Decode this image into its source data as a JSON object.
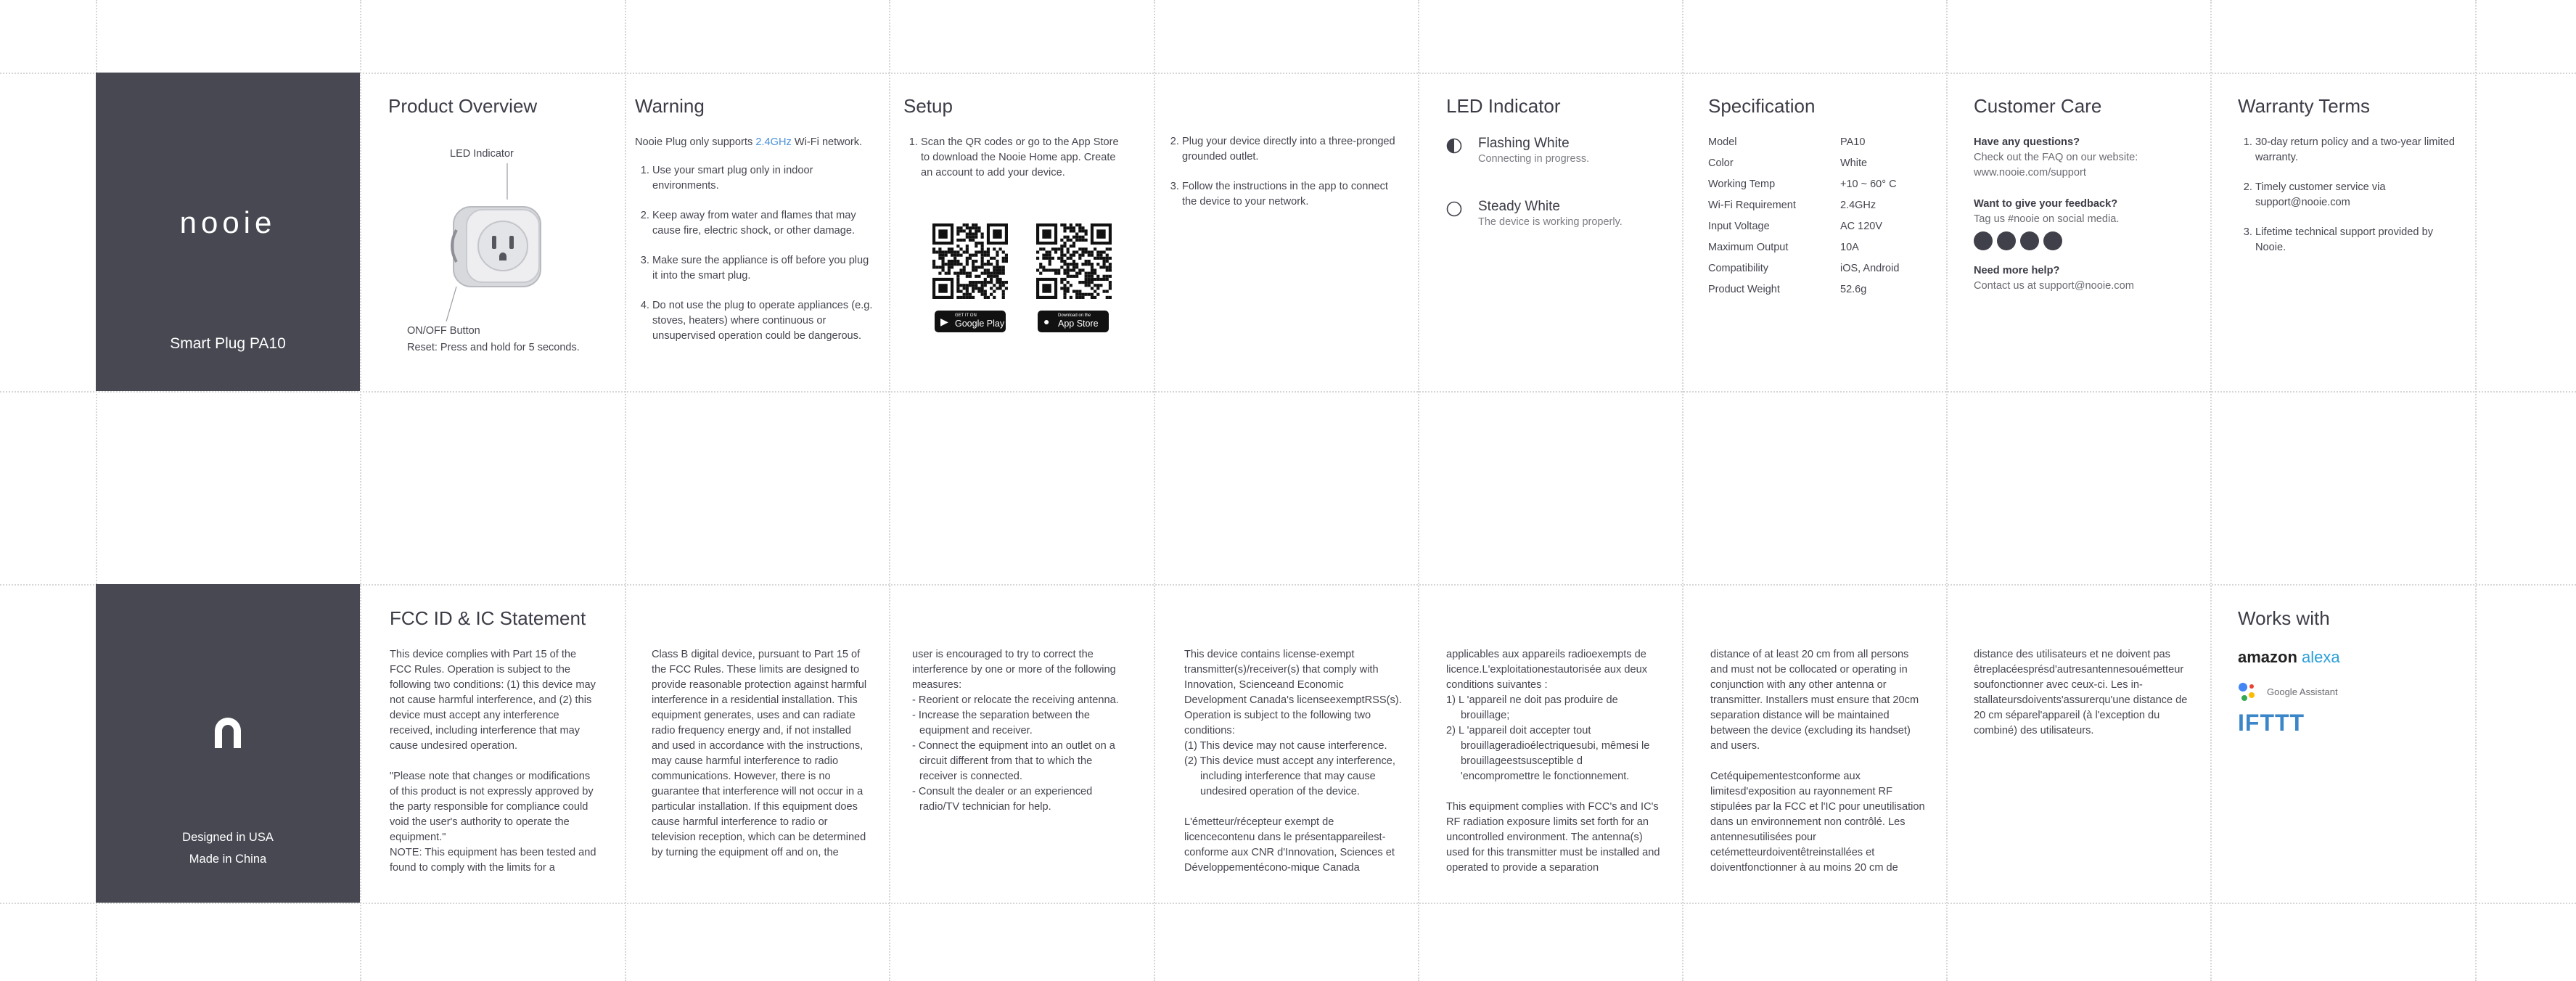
{
  "cover_top": {
    "logo": "nooie",
    "subtitle": "Smart Plug PA10"
  },
  "product_overview": {
    "title": "Product Overview",
    "led_label": "LED Indicator",
    "button_label": "ON/OFF Button",
    "reset_label": "Reset: Press and hold for 5 seconds."
  },
  "warning": {
    "title": "Warning",
    "intro_before": "Nooie Plug only supports ",
    "intro_highlight": "2.4GHz",
    "intro_after": " Wi-Fi network.",
    "items": [
      "Use your smart plug only in indoor environments.",
      "Keep away from water and flames that may cause fire, electric shock, or other damage.",
      "Make sure the appliance is off before you plug it into the smart plug.",
      "Do not use the plug to operate appliances (e.g. stoves, heaters) where continuous or unsupervised operation could be dangerous."
    ]
  },
  "setup": {
    "title": "Setup",
    "step1": "Scan the QR codes or go to the App Store to download the Nooie Home app. Create an account to add your device.",
    "google_small": "GET IT ON",
    "google_big": "Google Play",
    "apple_small": "Download on the",
    "apple_big": "App Store",
    "step2": "Plug your device directly into a three-pronged grounded outlet.",
    "step3": "Follow the instructions in the app to connect the device to your network."
  },
  "led": {
    "title": "LED Indicator",
    "rows": [
      {
        "title": "Flashing White",
        "desc": "Connecting in progress."
      },
      {
        "title": "Steady White",
        "desc": "The device is working properly."
      }
    ]
  },
  "spec": {
    "title": "Specification",
    "rows": [
      {
        "k": "Model",
        "v": "PA10"
      },
      {
        "k": "Color",
        "v": "White"
      },
      {
        "k": "Working Temp",
        "v": "+10 ~ 60° C"
      },
      {
        "k": "Wi-Fi Requirement",
        "v": "2.4GHz"
      },
      {
        "k": "Input Voltage",
        "v": "AC 120V"
      },
      {
        "k": "Maximum Output",
        "v": "10A"
      },
      {
        "k": "Compatibility",
        "v": "iOS, Android"
      },
      {
        "k": "Product Weight",
        "v": "52.6g"
      }
    ]
  },
  "care": {
    "title": "Customer Care",
    "q1": "Have any questions?",
    "a1": "Check out the FAQ on our website:",
    "a1b": "www.nooie.com/support",
    "q2": "Want to give your feedback?",
    "a2": "Tag us #nooie on social media.",
    "social_icons": [
      "facebook-icon",
      "instagram-icon",
      "twitter-icon",
      "youtube-icon"
    ],
    "q3": "Need more help?",
    "a3": "Contact us at support@nooie.com"
  },
  "warranty": {
    "title": "Warranty Terms",
    "items": [
      "30-day return policy and a two-year limited warranty.",
      "Timely customer service via support@nooie.com",
      "Lifetime technical support provided by Nooie."
    ]
  },
  "cover_bottom": {
    "line1": "Designed in USA",
    "line2": "Made in China"
  },
  "fcc": {
    "title": "FCC ID & IC Statement",
    "col1_p1": "This device complies with Part 15 of the FCC Rules. Operation is subject to the following two conditions: (1) this device may not cause harmful interference, and (2) this device must accept any interference received, including interference that may cause undesired operation.",
    "col1_p2": "\"Please note that changes or modifications of this product is not expressly approved by the party responsible for compliance could void the user's authority to operate the equipment.\"",
    "col1_p3": "NOTE: This equipment has been tested and found to comply with the limits for a",
    "col2": "Class B digital device, pursuant to Part 15 of the FCC Rules. These limits are designed to provide reasonable protection against harmful interference in a residential installation. This equipment generates, uses and can radiate radio frequency energy and, if not installed and used in accordance with the instructions, may cause harmful interference to radio communications. However, there is no guarantee that interference will not occur in a particular installation. If this equipment does cause harmful interference to radio or television reception, which can be determined by turning the equipment off and on, the",
    "col3_intro": "user is encouraged to try to correct the interference by one or more of the following measures:",
    "col3_items": [
      "- Reorient or relocate the receiving antenna.",
      "- Increase the separation between the equipment and receiver.",
      "- Connect the equipment into an outlet on a circuit different from that to which the receiver is connected.",
      "- Consult the dealer or an experienced radio/TV technician for help."
    ],
    "col4_p1": "This device contains license-exempt transmitter(s)/receiver(s) that comply with Innovation, Scienceand Economic Development Canada's licenseexemptRSS(s). Operation is subject to the following two conditions:",
    "col4_i1": "(1) This device may not cause interference.",
    "col4_i2": "(2) This device must accept any interference, including interference that may cause undesired operation of the device.",
    "col4_p2": "L'émetteur/récepteur exempt de licencecontenu dans le présentappareilest-conforme aux CNR d'Innovation, Sciences et Développementécono-mique Canada",
    "col5_p1": "applicables aux appareils radioexempts de licence.L'exploitationestautorisée aux deux conditions suivantes :",
    "col5_i1": "1) L 'appareil ne doit pas produire de brouillage;",
    "col5_i2": "2) L 'appareil doit accepter tout brouillageradioélectriquesubi, mêmesi le brouillageestsusceptible d 'encompromettre le fonctionnement.",
    "col5_p2": "This equipment complies with FCC's and IC's RF radiation exposure limits set forth for an uncontrolled environment. The antenna(s) used for this transmitter must be installed and operated to provide a separation",
    "col6_p1": "distance of at least 20 cm from all persons and must not be collocated or operating in conjunction with any other antenna or transmitter. Installers must ensure that 20cm separation distance will be maintained between the device (excluding its handset) and users.",
    "col6_p2": "Cetéquipementestconforme aux limitesd'exposition au rayonnement RF stipulées par la FCC et l'IC pour uneutilisation dans un environnement non contrôlé. Les antennesutilisées pour cetémetteurdoiventêtreinstallées et doiventfonctionner à au moins 20 cm de",
    "col7": "distance des utilisateurs et ne doivent pas êtreplacéesprésd'autresantennesouémetteur soufonctionner avec ceux-ci. Les in-stallateursdoivents'assurerqu'une distance de 20 cm séparel'appareil (à l'exception du combiné) des utilisateurs."
  },
  "works_with": {
    "title": "Works with",
    "alexa_a": "amazon",
    "alexa_b": "alexa",
    "google": "Google Assistant",
    "ifttt": "IFTTT"
  }
}
